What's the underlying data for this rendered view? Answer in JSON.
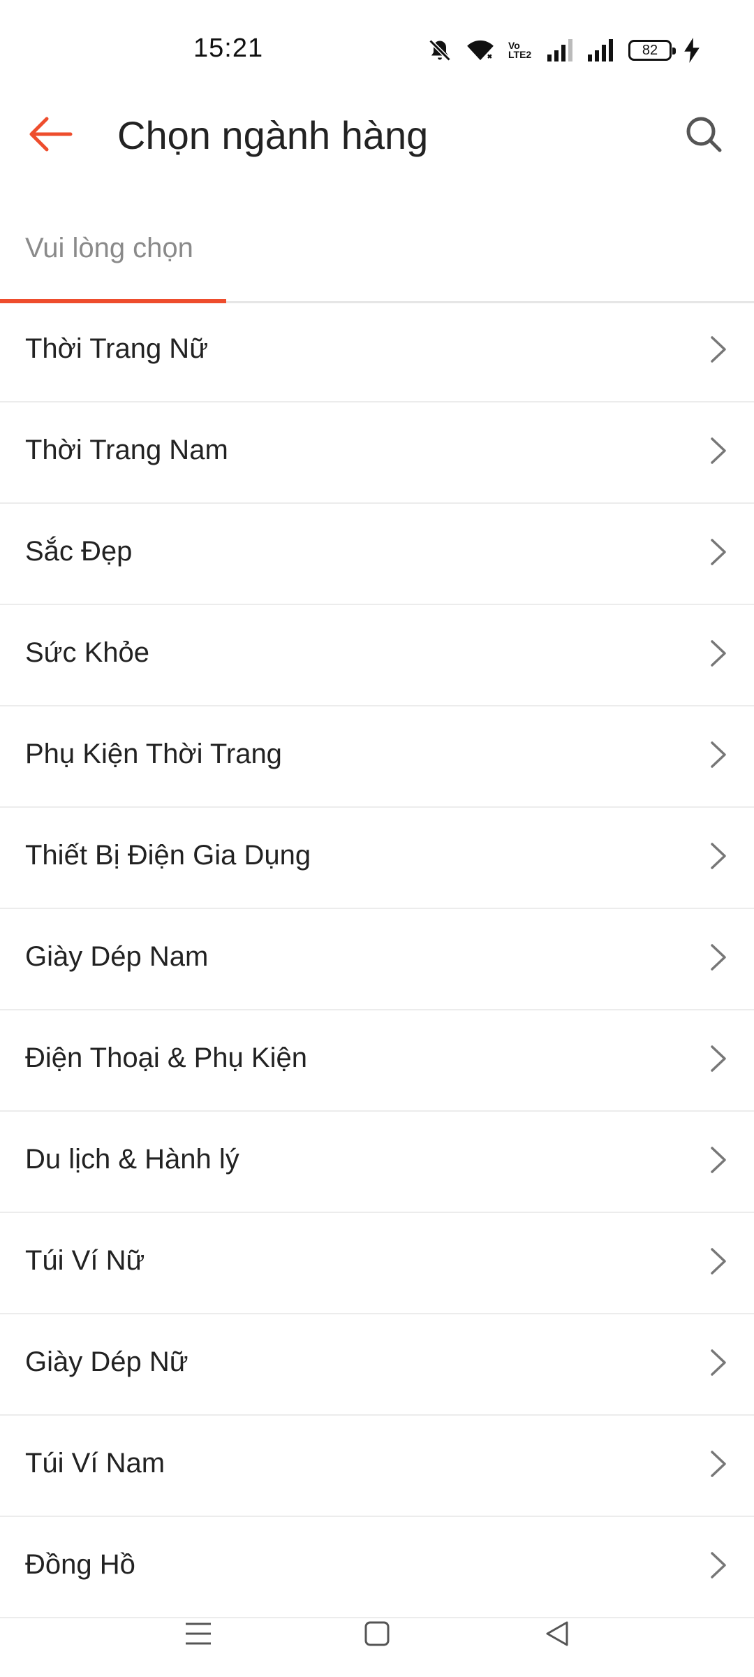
{
  "status_bar": {
    "time": "15:21",
    "battery_level": "82",
    "network_label": "Vo LTE2",
    "icons": [
      "bell-off-icon",
      "wifi-icon",
      "volte-icon",
      "signal-icon",
      "signal-icon",
      "battery-icon",
      "charging-icon"
    ]
  },
  "app_bar": {
    "title": "Chọn ngành hàng",
    "back_icon": "arrow-left-icon",
    "search_icon": "search-icon",
    "accent_color": "#ee4d2d"
  },
  "tabs": [
    {
      "label": "Vui lòng chọn",
      "active": true
    }
  ],
  "categories": [
    {
      "label": "Thời Trang Nữ"
    },
    {
      "label": "Thời Trang Nam"
    },
    {
      "label": "Sắc Đẹp"
    },
    {
      "label": "Sức Khỏe"
    },
    {
      "label": "Phụ Kiện Thời Trang"
    },
    {
      "label": "Thiết Bị Điện Gia Dụng"
    },
    {
      "label": "Giày Dép Nam"
    },
    {
      "label": "Điện Thoại & Phụ Kiện"
    },
    {
      "label": "Du lịch & Hành lý"
    },
    {
      "label": "Túi Ví Nữ"
    },
    {
      "label": "Giày Dép Nữ"
    },
    {
      "label": "Túi Ví Nam"
    },
    {
      "label": "Đồng Hồ"
    }
  ],
  "nav_bar": {
    "icons": [
      "menu-icon",
      "home-square-icon",
      "back-triangle-icon"
    ]
  }
}
